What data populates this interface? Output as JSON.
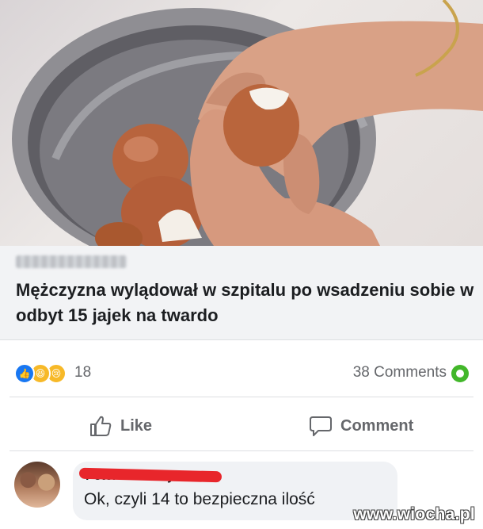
{
  "post": {
    "image_alt": "hands peeling boiled eggs over a pot",
    "headline": "Mężczyzna wylądował w szpitalu po wsadzeniu sobie w odbyt 15 jajek na twardo",
    "reactions": {
      "icons": [
        "like-icon",
        "haha-icon",
        "sad-icon"
      ],
      "count": "18"
    },
    "comments_count": "38 Comments"
  },
  "actions": {
    "like_label": "Like",
    "comment_label": "Comment"
  },
  "comment": {
    "name": "Peter Kennedy",
    "text": "Ok, czyli 14 to bezpieczna ilość"
  },
  "watermark": "www.wiocha.pl",
  "colors": {
    "facebook_blue": "#1877f2",
    "reaction_yellow": "#f7b928",
    "comments_green": "#42b72a",
    "redaction_red": "#e8262b"
  }
}
